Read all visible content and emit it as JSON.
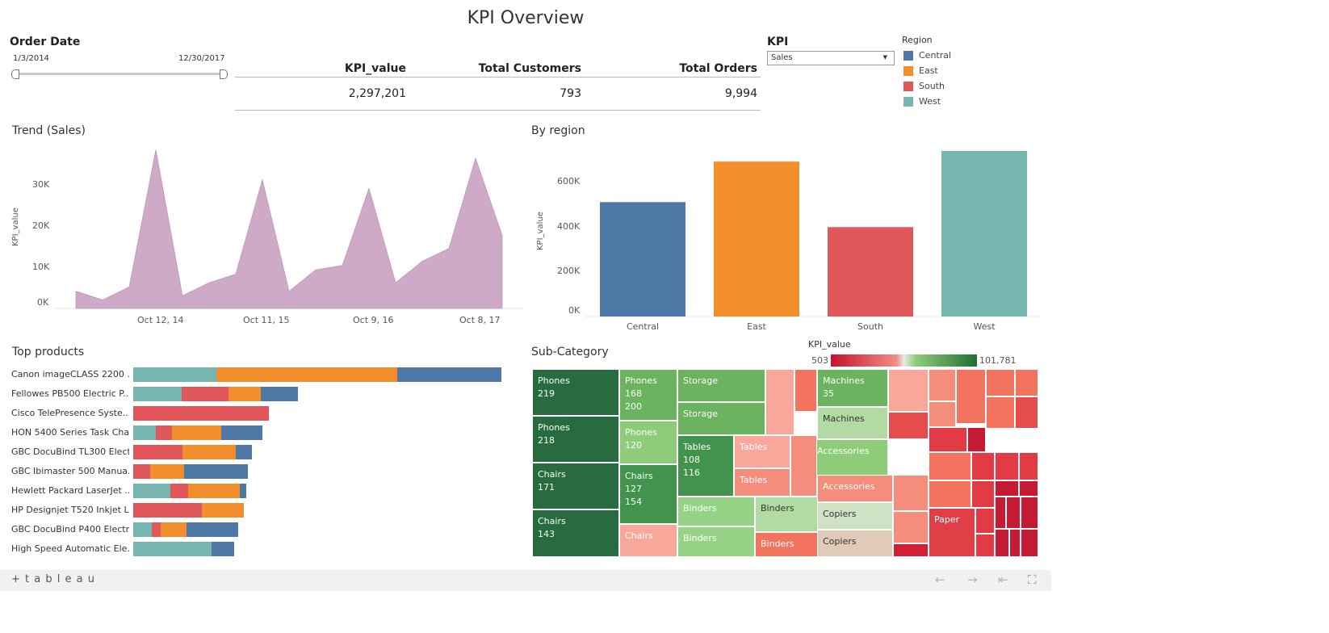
{
  "title": "KPI Overview",
  "order_date": {
    "label": "Order Date",
    "start": "1/3/2014",
    "end": "12/30/2017"
  },
  "kpi_table": {
    "headers": [
      "KPI_value",
      "Total Customers",
      "Total Orders"
    ],
    "values": [
      "2,297,201",
      "793",
      "9,994"
    ]
  },
  "kpi_selector": {
    "label": "KPI",
    "selected": "Sales"
  },
  "region_legend": {
    "title": "Region",
    "items": [
      {
        "name": "Central",
        "color": "#4e79a7"
      },
      {
        "name": "East",
        "color": "#f28e2b"
      },
      {
        "name": "South",
        "color": "#e15759"
      },
      {
        "name": "West",
        "color": "#76b7b2"
      }
    ]
  },
  "trend": {
    "title": "Trend (Sales)",
    "ylabel": "KPI_value",
    "yticks": [
      "30K",
      "20K",
      "10K",
      "0K"
    ],
    "xticks": [
      "Oct 12, 14",
      "Oct 11, 15",
      "Oct 9, 16",
      "Oct 8, 17"
    ],
    "color": "#cfa9c8"
  },
  "by_region": {
    "title": "By region",
    "ylabel": "KPI_value",
    "yticks": [
      "600K",
      "400K",
      "200K",
      "0K"
    ]
  },
  "top_products": {
    "title": "Top products"
  },
  "subcategory": {
    "title": "Sub-Category",
    "scale_title": "KPI_value",
    "scale_min": "503",
    "scale_max": "101,781"
  },
  "footer": {
    "brand": "+ t a b l e a u"
  },
  "chart_data": [
    {
      "type": "area",
      "title": "Trend (Sales)",
      "ylabel": "KPI_value",
      "ylim": [
        0,
        38000
      ],
      "x": [
        "2014-01",
        "2014-04",
        "2014-07",
        "2014-10",
        "2015-01",
        "2015-04",
        "2015-07",
        "2015-10",
        "2016-01",
        "2016-04",
        "2016-07",
        "2016-10",
        "2017-01",
        "2017-04",
        "2017-07",
        "2017-10",
        "2017-12"
      ],
      "values": [
        4000,
        2000,
        5000,
        37000,
        3000,
        6000,
        8000,
        30000,
        4000,
        9000,
        10000,
        28000,
        6000,
        11000,
        14000,
        35000,
        17000
      ]
    },
    {
      "type": "bar",
      "title": "By region",
      "ylabel": "KPI_value",
      "ylim": [
        0,
        750000
      ],
      "categories": [
        "Central",
        "East",
        "South",
        "West"
      ],
      "values": [
        501240,
        678781,
        391722,
        725458
      ],
      "colors": [
        "#4e79a7",
        "#f28e2b",
        "#e15759",
        "#76b7b2"
      ]
    },
    {
      "type": "bar",
      "title": "Top products",
      "categories": [
        "Canon imageCLASS 2200 ...",
        "Fellowes PB500 Electric P...",
        "Cisco TelePresence Syste...",
        "HON 5400 Series Task Cha...",
        "GBC DocuBind TL300 Elect...",
        "GBC Ibimaster 500 Manua...",
        "Hewlett Packard LaserJet ...",
        "HP Designjet T520 Inkjet L...",
        "GBC DocuBind P400 Electr...",
        "High Speed Automatic Ele..."
      ],
      "series": [
        {
          "name": "West",
          "values": [
            11200,
            6500,
            0,
            3000,
            0,
            0,
            5000,
            0,
            2500,
            10500
          ]
        },
        {
          "name": "South",
          "values": [
            0,
            6300,
            18300,
            2200,
            6600,
            2300,
            2400,
            9200,
            1200,
            0
          ]
        },
        {
          "name": "East",
          "values": [
            24300,
            4400,
            0,
            6600,
            7200,
            4500,
            6900,
            5700,
            3500,
            0
          ]
        },
        {
          "name": "Central",
          "values": [
            14100,
            5000,
            0,
            5600,
            2200,
            8600,
            900,
            0,
            6900,
            3100
          ]
        }
      ]
    }
  ],
  "treemap": [
    {
      "label": "Phones",
      "value": "219",
      "color": "#276b3e"
    },
    {
      "label": "Phones",
      "value": "218",
      "color": "#276b3e"
    },
    {
      "label": "Chairs",
      "value": "171",
      "color": "#276b3e"
    },
    {
      "label": "Chairs",
      "value": "143",
      "color": "#276b3e"
    },
    {
      "label": "Phones",
      "value": "168\n200",
      "color": "#6cb35f"
    },
    {
      "label": "Phones",
      "value": "120",
      "color": "#8fcc7a"
    },
    {
      "label": "Chairs",
      "value": "127\n154",
      "color": "#42934c"
    },
    {
      "label": "Chairs",
      "value": "",
      "color": "#f8a89a"
    },
    {
      "label": "Storage",
      "value": "",
      "color": "#6cb35f"
    },
    {
      "label": "Storage",
      "value": "",
      "color": "#6cb35f"
    },
    {
      "label": "Tables",
      "value": "108\n116",
      "color": "#42934c"
    },
    {
      "label": "Tables",
      "value": "",
      "color": "#f8a89a"
    },
    {
      "label": "Tables",
      "value": "",
      "color": "#f58d7c"
    },
    {
      "label": "Binders",
      "value": "",
      "color": "#97d387"
    },
    {
      "label": "Binders",
      "value": "",
      "color": "#97d387"
    },
    {
      "label": "Binders",
      "value": "",
      "color": "#b2daa3"
    },
    {
      "label": "Binders",
      "value": "",
      "color": "#f2745f"
    },
    {
      "label": "Machines",
      "value": "35",
      "color": "#6cb35f"
    },
    {
      "label": "Machines",
      "value": "",
      "color": "#b2daa3"
    },
    {
      "label": "Accessories",
      "value": "",
      "color": "#8fcc7a"
    },
    {
      "label": "Accessories",
      "value": "",
      "color": "#f58d7c"
    },
    {
      "label": "Copiers",
      "value": "",
      "color": "#cfe3c4"
    },
    {
      "label": "Copiers",
      "value": "",
      "color": "#e0cbb8"
    },
    {
      "label": "Paper",
      "value": "",
      "color": "#e13f48"
    }
  ]
}
